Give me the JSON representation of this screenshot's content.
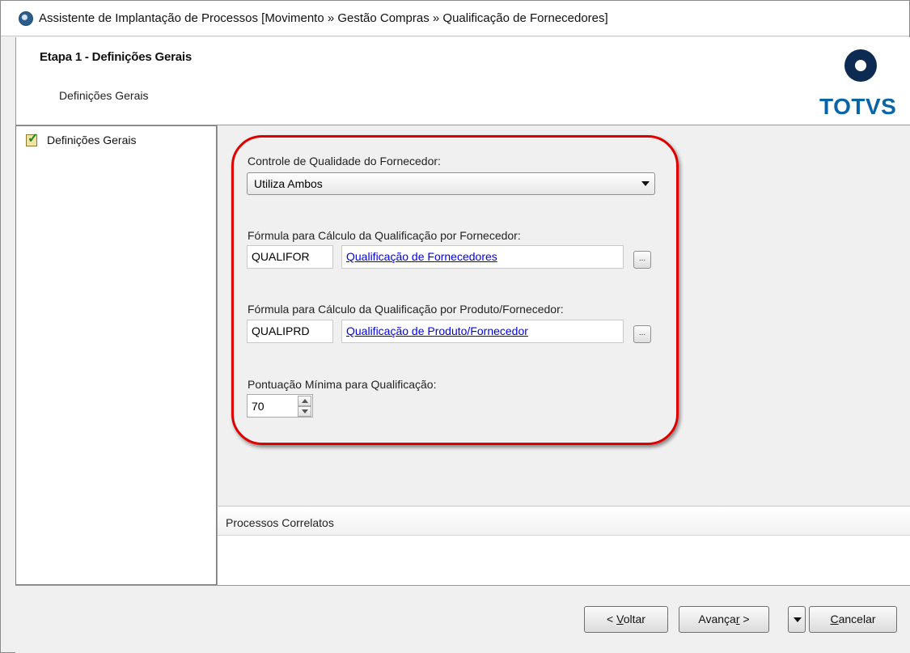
{
  "window": {
    "title": "Assistente de Implantação de Processos [Movimento » Gestão Compras » Qualificação de Fornecedores]"
  },
  "header": {
    "step_title": "Etapa 1 - Definições Gerais",
    "step_subtitle": "Definições Gerais",
    "logo_text": "TOTVS"
  },
  "sidebar": {
    "items": [
      {
        "label": "Definições Gerais",
        "icon": "checked-clipboard-icon"
      }
    ]
  },
  "form": {
    "quality_control": {
      "label": "Controle de Qualidade do Fornecedor:",
      "selected": "Utiliza Ambos"
    },
    "supplier_formula": {
      "label": "Fórmula para Cálculo da Qualificação por Fornecedor:",
      "code": "QUALIFOR",
      "description": "Qualificação de Fornecedores",
      "button": "..."
    },
    "product_supplier_formula": {
      "label": "Fórmula para Cálculo da Qualificação por Produto/Fornecedor:",
      "code": "QUALIPRD",
      "description": "Qualificação de Produto/Fornecedor",
      "button": "..."
    },
    "min_score": {
      "label": "Pontuação Mínima para Qualificação:",
      "value": "70"
    }
  },
  "related": {
    "title": "Processos Correlatos"
  },
  "footer": {
    "back_prefix": "< ",
    "back_mnemonic": "V",
    "back_rest": "oltar",
    "next_prefix": "Avança",
    "next_mnemonic": "r",
    "next_rest": " >",
    "cancel_mnemonic": "C",
    "cancel_rest": "ancelar"
  },
  "colors": {
    "highlight_border": "#e00000",
    "link": "#0000ee",
    "logo_blue": "#0a64a8",
    "logo_dark": "#0d2b52"
  }
}
